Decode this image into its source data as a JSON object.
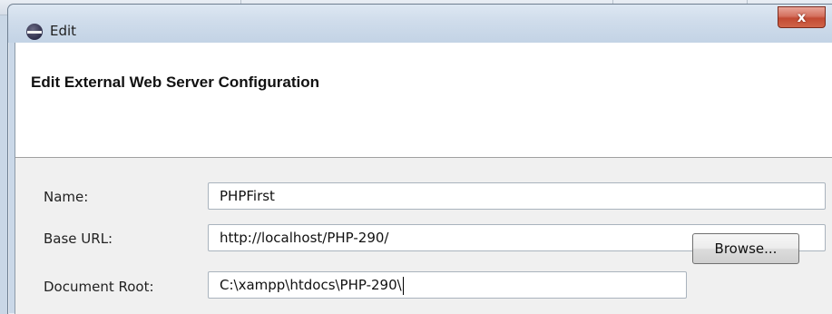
{
  "window": {
    "title": "Edit",
    "close_glyph": "x"
  },
  "header": {
    "title": "Edit External Web Server Configuration"
  },
  "form": {
    "name_label": "Name:",
    "name_value": "PHPFirst",
    "base_url_label": "Base URL:",
    "base_url_value": "http://localhost/PHP-290/",
    "doc_root_label": "Document Root:",
    "doc_root_value": "C:\\xampp\\htdocs\\PHP-290\\",
    "browse_label": "Browse..."
  },
  "icons": {
    "app": "eclipse-icon",
    "close": "close-icon"
  },
  "colors": {
    "close_button": "#c9553e",
    "header_background": "#ffffff",
    "dialog_background": "#f0f0f0"
  }
}
